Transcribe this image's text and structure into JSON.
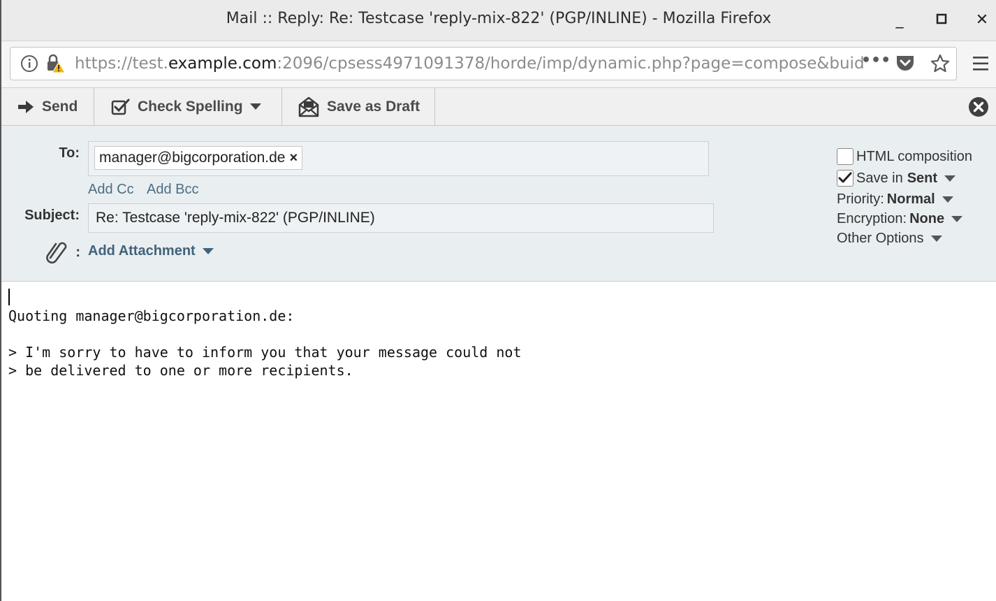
{
  "window": {
    "title": "Mail :: Reply: Re: Testcase 'reply-mix-822' (PGP/INLINE) - Mozilla Firefox",
    "min": "_",
    "max": "◻",
    "close": "✕"
  },
  "urlbar": {
    "prefix": "https://test.",
    "domain": "example.com",
    "rest": ":2096/cpsess4971091378/horde/imp/dynamic.php?page=compose&buid=",
    "more": "•••"
  },
  "toolbar": {
    "send": "Send",
    "check_spelling": "Check Spelling",
    "save_draft": "Save as Draft"
  },
  "header": {
    "to_label": "To:",
    "to_recipient": "manager@bigcorporation.de",
    "remove": "×",
    "add_cc": "Add Cc",
    "add_bcc": "Add Bcc",
    "subject_label": "Subject:",
    "subject_value": "Re: Testcase 'reply-mix-822' (PGP/INLINE)",
    "attach_colon": ":",
    "add_attachment": "Add Attachment"
  },
  "options": {
    "html_composition": "HTML composition",
    "save_in": "Save in",
    "save_folder": "Sent",
    "priority_label": "Priority:",
    "priority_value": "Normal",
    "encryption_label": "Encryption:",
    "encryption_value": "None",
    "other_options": "Other Options"
  },
  "body": {
    "lines": [
      "Quoting manager@bigcorporation.de:",
      "",
      "> I'm sorry to have to inform you that your message could not",
      "> be delivered to one or more recipients."
    ]
  }
}
